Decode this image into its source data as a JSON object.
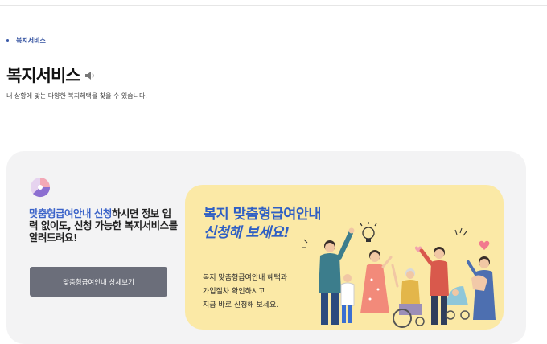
{
  "breadcrumb": {
    "current": "복지서비스"
  },
  "page": {
    "title": "복지서비스",
    "description": "내 상황에 맞는 다양한 복지혜택을 찾을 수 있습니다."
  },
  "promo": {
    "headline_highlight": "맞춤형급여안내 신청",
    "headline_rest": "하시면 정보 입력 없이도, 신청 가능한 복지서비스를 알려드려요!",
    "button_label": "맞춤형급여안내 상세보기"
  },
  "banner": {
    "title_line1": "복지 맞춤형급여안내",
    "title_line2": "신청해 보세요!",
    "body_lines": [
      "복지 맞춤형급여안내 혜택과",
      "가입절차 확인하시고",
      "지금 바로 신청해 보세요."
    ]
  },
  "icons": [
    "speaker-icon",
    "pie-chart-icon",
    "families-illustration"
  ],
  "colors": {
    "accent_blue": "#3b63c9",
    "banner_yellow": "#fbe9a6",
    "button_gray": "#6b6e7a",
    "panel_gray": "#f3f3f4"
  }
}
